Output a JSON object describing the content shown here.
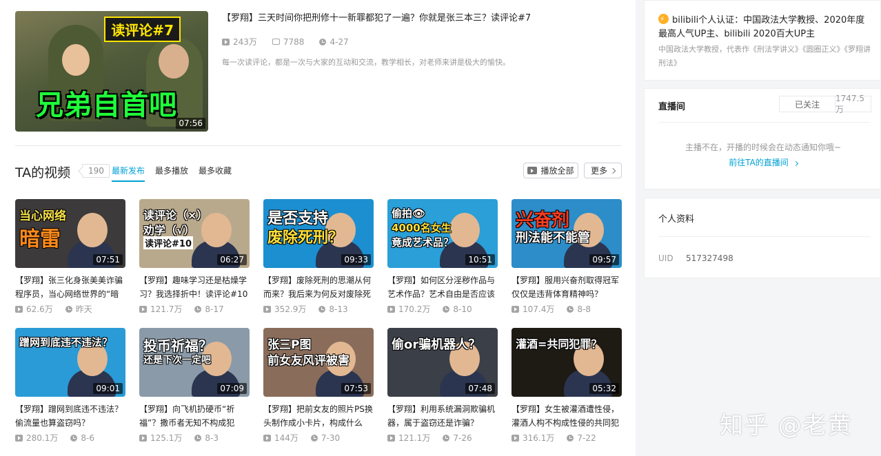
{
  "featured": {
    "title": "【罗翔】三天时间你把刑修十一新罪都犯了一遍？你就是张三本三？读评论#7",
    "duration": "07:56",
    "plays": "243万",
    "comments": "7788",
    "date": "4-27",
    "description": "每一次读评论，都是一次与大家的互动和交流，教学相长，对老师来讲是极大的愉快。",
    "cover_tag": "读评论#7",
    "cover_text": "兄弟自首吧"
  },
  "videos_section": {
    "title": "TA的视频",
    "count": "190",
    "tabs": [
      "最新发布",
      "最多播放",
      "最多收藏"
    ],
    "play_all": "播放全部",
    "more": "更多"
  },
  "videos": [
    {
      "title": "【罗翔】张三化身张美美诈骗程序员，当心网络世界的“暗雷”",
      "duration": "07:51",
      "plays": "62.6万",
      "date": "昨天",
      "thumb_lines": [
        "当心网络",
        "暗雷"
      ],
      "bg": "#3c3a3a"
    },
    {
      "title": "【罗翔】趣味学习还是枯燥学习？我选择折中！读评论#10",
      "duration": "06:27",
      "plays": "121.7万",
      "date": "8-17",
      "thumb_lines": [
        "读评论（×）",
        "劝学（√）",
        "读评论#10"
      ],
      "bg": "#b9a98c"
    },
    {
      "title": "【罗翔】废除死刑的思潮从何而来？我后来为何反对废除死刑？",
      "duration": "09:33",
      "plays": "352.9万",
      "date": "8-13",
      "thumb_lines": [
        "是否支持",
        "废除死刑？"
      ],
      "bg": "#1c8fd0"
    },
    {
      "title": "【罗翔】如何区分淫秽作品与艺术作品？艺术自由是否应该有边界？",
      "duration": "10:51",
      "plays": "170.2万",
      "date": "8-10",
      "thumb_lines": [
        "偷拍👁",
        "4000名女生",
        "竟成艺术品？"
      ],
      "bg": "#2a9fd8"
    },
    {
      "title": "【罗翔】服用兴奋剂取得冠军仅仅是违背体育精神吗？",
      "duration": "09:57",
      "plays": "107.4万",
      "date": "8-8",
      "thumb_lines": [
        "兴奋剂",
        "刑法能不能管"
      ],
      "bg": "#2c8dc9"
    },
    {
      "title": "【罗翔】蹭网到底违不违法？偷流量也算盗窃吗？",
      "duration": "09:01",
      "plays": "280.1万",
      "date": "8-6",
      "thumb_lines": [
        "蹭网到底违不违法？"
      ],
      "bg": "#2a9bd6"
    },
    {
      "title": "【罗翔】向飞机扔硬币“祈福”？撒币者无知不构成犯罪？",
      "duration": "07:09",
      "plays": "125.1万",
      "date": "8-3",
      "thumb_lines": [
        "投币祈福？",
        "还是下次一定吧"
      ],
      "bg": "#8a9aa8"
    },
    {
      "title": "【罗翔】把前女友的照片PS换头制作成小卡片，构成什么罪？",
      "duration": "07:53",
      "plays": "144万",
      "date": "7-30",
      "thumb_lines": [
        "张三P图",
        "前女友风评被害"
      ],
      "bg": "#8a6c5a"
    },
    {
      "title": "【罗翔】利用系统漏洞欺骗机器，属于盗窃还是诈骗？",
      "duration": "07:48",
      "plays": "121.1万",
      "date": "7-26",
      "thumb_lines": [
        "偷or骗机器人？"
      ],
      "bg": "#3b3f48"
    },
    {
      "title": "【罗翔】女生被灌酒遭性侵，灌酒人构不构成性侵的共同犯罪？",
      "duration": "05:32",
      "plays": "316.1万",
      "date": "7-22",
      "thumb_lines": [
        "灌酒=共同犯罪？"
      ],
      "bg": "#1e1a14"
    }
  ],
  "sidebar": {
    "cert_main": "bilibili个人认证：中国政法大学教授、2020年度最高人气UP主、bilibili 2020百大UP主",
    "cert_sub": "中国政法大学教授，代表作《刑法学讲义》《圆圈正义》《罗翔讲刑法》",
    "live_title": "直播间",
    "follow_label": "已关注",
    "fans": "1747.5万",
    "live_msg": "主播不在，开播的时候会在动态通知你哦~",
    "live_link": "前往TA的直播间",
    "profile_title": "个人资料",
    "uid_label": "UID",
    "uid": "517327498"
  },
  "watermark": "知乎 @老黄"
}
